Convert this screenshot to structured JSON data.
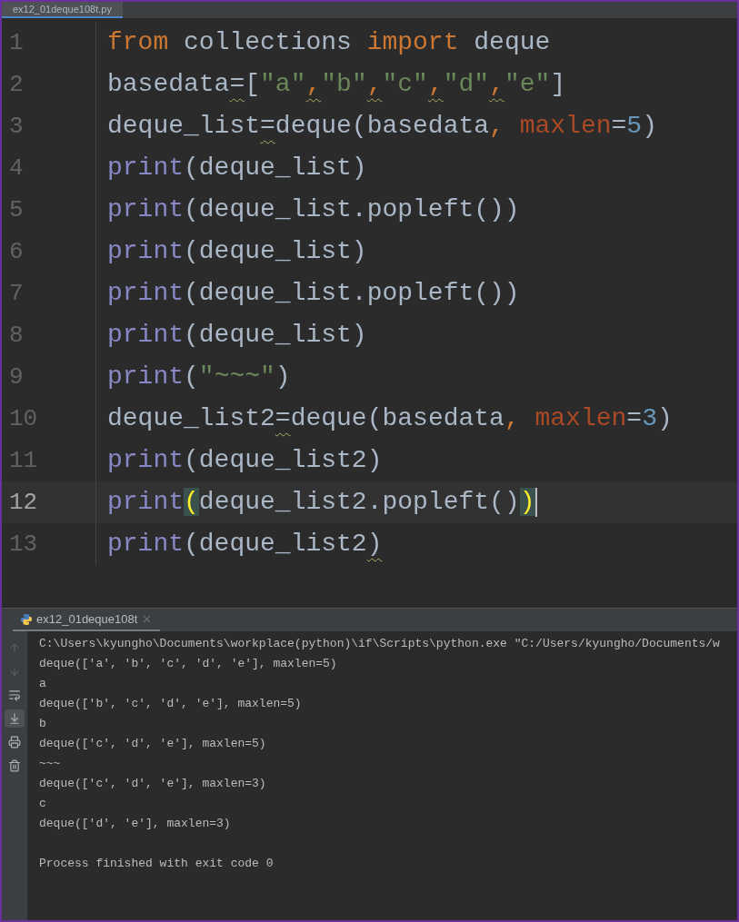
{
  "editor_tab": {
    "label": "ex12_01deque108t.py",
    "selected": true
  },
  "code_lines": [
    {
      "number": "1",
      "current": false,
      "tokens": [
        {
          "text": "from",
          "kind": "keyword"
        },
        {
          "text": " collections ",
          "kind": "ident"
        },
        {
          "text": "import",
          "kind": "keyword"
        },
        {
          "text": " deque",
          "kind": "ident"
        }
      ]
    },
    {
      "number": "2",
      "current": false,
      "tokens": [
        {
          "text": "basedata",
          "kind": "ident"
        },
        {
          "text": "=",
          "kind": "warn"
        },
        {
          "text": "[",
          "kind": "ident"
        },
        {
          "text": "\"a\"",
          "kind": "string"
        },
        {
          "text": ",",
          "kind": "comma-warn"
        },
        {
          "text": "\"b\"",
          "kind": "string"
        },
        {
          "text": ",",
          "kind": "comma-warn"
        },
        {
          "text": "\"c\"",
          "kind": "string"
        },
        {
          "text": ",",
          "kind": "comma-warn"
        },
        {
          "text": "\"d\"",
          "kind": "string"
        },
        {
          "text": ",",
          "kind": "comma-warn"
        },
        {
          "text": "\"e\"",
          "kind": "string"
        },
        {
          "text": "]",
          "kind": "ident"
        }
      ]
    },
    {
      "number": "3",
      "current": false,
      "tokens": [
        {
          "text": "deque_list",
          "kind": "ident"
        },
        {
          "text": "=",
          "kind": "warn"
        },
        {
          "text": "deque(basedata",
          "kind": "ident"
        },
        {
          "text": ", ",
          "kind": "keyword"
        },
        {
          "text": "maxlen",
          "kind": "param"
        },
        {
          "text": "=",
          "kind": "ident"
        },
        {
          "text": "5",
          "kind": "number"
        },
        {
          "text": ")",
          "kind": "ident"
        }
      ]
    },
    {
      "number": "4",
      "current": false,
      "tokens": [
        {
          "text": "print",
          "kind": "builtin"
        },
        {
          "text": "(deque_list)",
          "kind": "ident"
        }
      ]
    },
    {
      "number": "5",
      "current": false,
      "tokens": [
        {
          "text": "print",
          "kind": "builtin"
        },
        {
          "text": "(deque_list.popleft())",
          "kind": "ident"
        }
      ]
    },
    {
      "number": "6",
      "current": false,
      "tokens": [
        {
          "text": "print",
          "kind": "builtin"
        },
        {
          "text": "(deque_list)",
          "kind": "ident"
        }
      ]
    },
    {
      "number": "7",
      "current": false,
      "tokens": [
        {
          "text": "print",
          "kind": "builtin"
        },
        {
          "text": "(deque_list.popleft())",
          "kind": "ident"
        }
      ]
    },
    {
      "number": "8",
      "current": false,
      "tokens": [
        {
          "text": "print",
          "kind": "builtin"
        },
        {
          "text": "(deque_list)",
          "kind": "ident"
        }
      ]
    },
    {
      "number": "9",
      "current": false,
      "tokens": [
        {
          "text": "print",
          "kind": "builtin"
        },
        {
          "text": "(",
          "kind": "ident"
        },
        {
          "text": "\"~~~\"",
          "kind": "string"
        },
        {
          "text": ")",
          "kind": "ident"
        }
      ]
    },
    {
      "number": "10",
      "current": false,
      "tokens": [
        {
          "text": "deque_list2",
          "kind": "ident"
        },
        {
          "text": "=",
          "kind": "warn"
        },
        {
          "text": "deque(basedata",
          "kind": "ident"
        },
        {
          "text": ", ",
          "kind": "keyword"
        },
        {
          "text": "maxlen",
          "kind": "param"
        },
        {
          "text": "=",
          "kind": "ident"
        },
        {
          "text": "3",
          "kind": "number"
        },
        {
          "text": ")",
          "kind": "ident"
        }
      ]
    },
    {
      "number": "11",
      "current": false,
      "tokens": [
        {
          "text": "print",
          "kind": "builtin"
        },
        {
          "text": "(deque_list2)",
          "kind": "ident"
        }
      ]
    },
    {
      "number": "12",
      "current": true,
      "tokens": [
        {
          "text": "print",
          "kind": "builtin"
        },
        {
          "text": "(",
          "kind": "brace"
        },
        {
          "text": "deque_list2.popleft()",
          "kind": "ident"
        },
        {
          "text": ")",
          "kind": "brace"
        }
      ]
    },
    {
      "number": "13",
      "current": false,
      "tokens": [
        {
          "text": "print",
          "kind": "builtin"
        },
        {
          "text": "(deque_list2",
          "kind": "ident"
        },
        {
          "text": ")",
          "kind": "warn"
        }
      ]
    }
  ],
  "run_tab": {
    "label": "ex12_01deque108t",
    "selected": true
  },
  "console": {
    "lines": [
      "C:\\Users\\kyungho\\Documents\\workplace(python)\\if\\Scripts\\python.exe \"C:/Users/kyungho/Documents/w",
      "deque(['a', 'b', 'c', 'd', 'e'], maxlen=5)",
      "a",
      "deque(['b', 'c', 'd', 'e'], maxlen=5)",
      "b",
      "deque(['c', 'd', 'e'], maxlen=5)",
      "~~~",
      "deque(['c', 'd', 'e'], maxlen=3)",
      "c",
      "deque(['d', 'e'], maxlen=3)"
    ],
    "exit_message": "Process finished with exit code 0"
  }
}
